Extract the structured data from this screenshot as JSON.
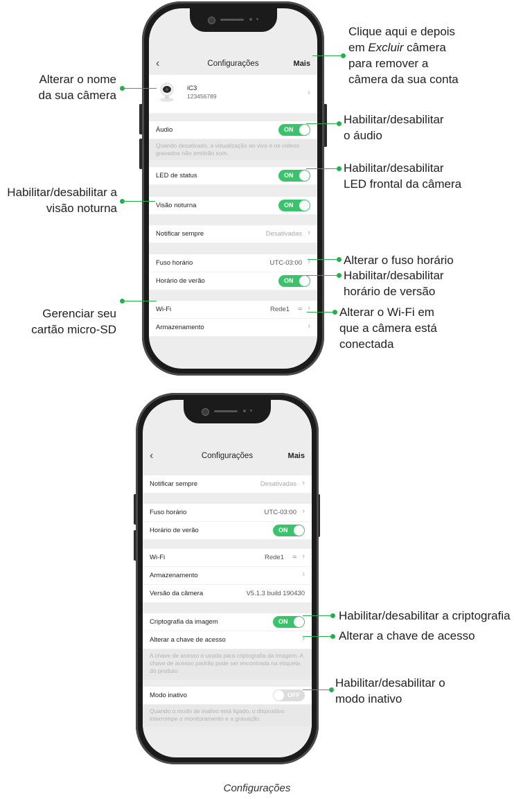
{
  "phone1": {
    "header": {
      "title": "Configurações",
      "more": "Mais"
    },
    "device": {
      "name": "iC3",
      "serial": "123456789"
    },
    "audio": {
      "label": "Áudio",
      "toggle": "ON",
      "note": "Quando desativado, a visualização ao vivo e os vídeos gravados não emitirão som."
    },
    "led": {
      "label": "LED de status",
      "toggle": "ON"
    },
    "night": {
      "label": "Visão noturna",
      "toggle": "ON"
    },
    "notify": {
      "label": "Notificar sempre",
      "value": "Desativadas"
    },
    "timezone": {
      "label": "Fuso horário",
      "value": "UTC-03:00"
    },
    "dst": {
      "label": "Horário de verão",
      "toggle": "ON"
    },
    "wifi": {
      "label": "Wi-Fi",
      "value": "Rede1"
    },
    "storage": {
      "label": "Armazenamento"
    }
  },
  "phone2": {
    "header": {
      "title": "Configurações",
      "more": "Mais"
    },
    "notify": {
      "label": "Notificar sempre",
      "value": "Desativadas"
    },
    "timezone": {
      "label": "Fuso horário",
      "value": "UTC-03:00"
    },
    "dst": {
      "label": "Horário de verão",
      "toggle": "ON"
    },
    "wifi": {
      "label": "Wi-Fi",
      "value": "Rede1"
    },
    "storage": {
      "label": "Armazenamento"
    },
    "version": {
      "label": "Versão da câmera",
      "value": "V5.1.3 build 190430"
    },
    "crypto": {
      "label": "Criptografia da imagem",
      "toggle": "ON"
    },
    "key": {
      "label": "Alterar a chave de acesso",
      "note": "A chave de acesso é usada para criptografia da imagem. A chave de acesso padrão pode ser encontrada na etiqueta do produto"
    },
    "idle": {
      "label": "Modo inativo",
      "toggle": "OFF",
      "note": "Quando o modo de inativo está ligado, o dispositivo interrompe o monitoramento e a gravação."
    }
  },
  "annotations": {
    "mais_l1": "Clique aqui e depois",
    "mais_l2_pre": "em ",
    "mais_l2_em": "Excluir",
    "mais_l2_post": " câmera",
    "mais_l3": "para remover a",
    "mais_l4": "câmera da sua conta",
    "name_l1": "Alterar o nome",
    "name_l2": "da sua câmera",
    "audio_l1": "Habilitar/desabilitar",
    "audio_l2": "o áudio",
    "led_l1": "Habilitar/desabilitar",
    "led_l2": "LED frontal da câmera",
    "night_l1": "Habilitar/desabilitar a",
    "night_l2": "visão noturna",
    "tz": "Alterar o fuso horário",
    "dst_l1": "Habilitar/desabilitar",
    "dst_l2": "horário de versão",
    "sd_l1": "Gerenciar seu",
    "sd_l2": "cartão micro-SD",
    "wifi_l1": "Alterar o Wi-Fi em",
    "wifi_l2": "que a câmera está",
    "wifi_l3": "conectada",
    "crypto": "Habilitar/desabilitar a criptografia",
    "key": "Alterar a chave de acesso",
    "idle_l1": "Habilitar/desabilitar o",
    "idle_l2": "modo inativo"
  },
  "caption": "Configurações",
  "colors": {
    "accent": "#22b14c",
    "toggle_on": "#3ac36a",
    "toggle_off": "#dcdcdc",
    "phone_body": "#1b1b1b"
  }
}
